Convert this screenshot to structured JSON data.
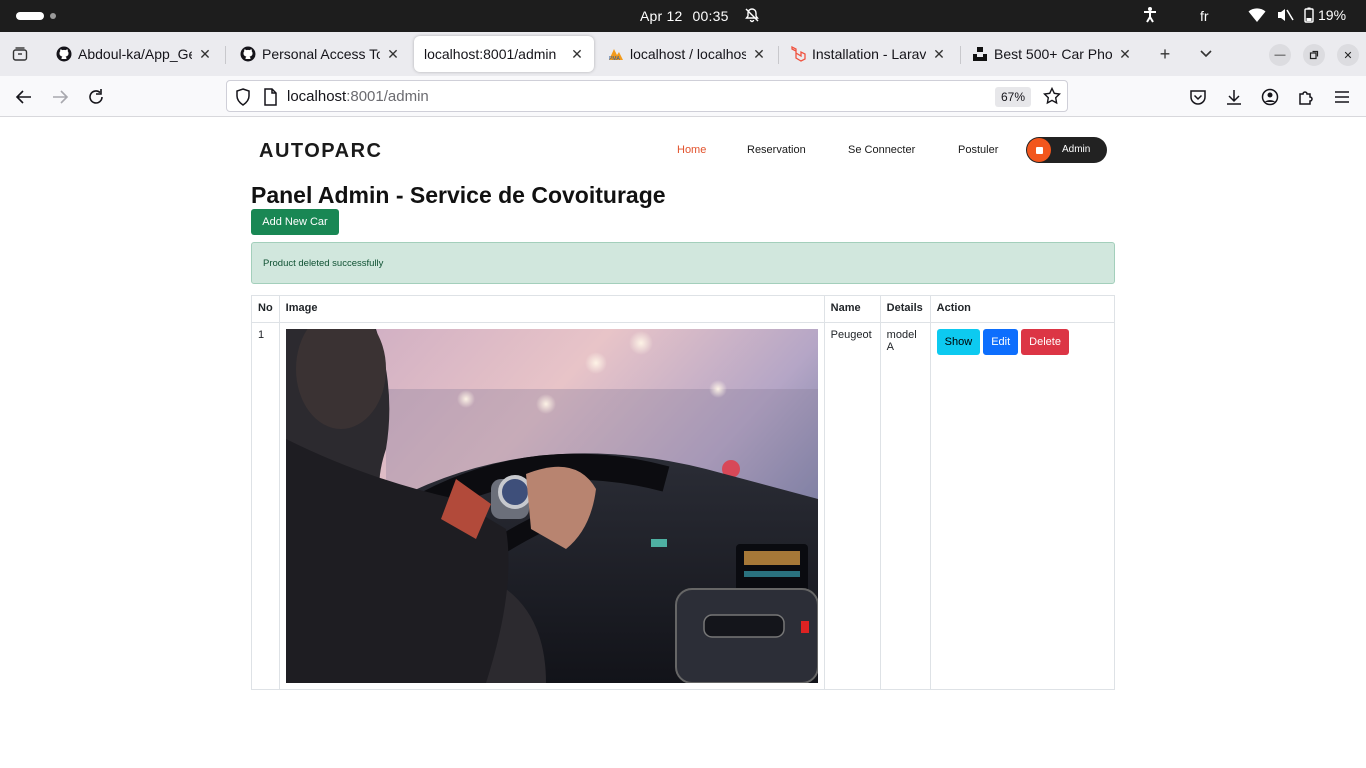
{
  "os": {
    "date": "Apr 12",
    "time": "00:35",
    "language": "fr",
    "battery": "19%"
  },
  "browser": {
    "tabs": [
      {
        "label": "Abdoul-ka/App_Ge",
        "icon": "github-icon"
      },
      {
        "label": "Personal Access To",
        "icon": "github-icon"
      },
      {
        "label": "localhost:8001/admin",
        "icon": "none",
        "active": true
      },
      {
        "label": "localhost / localhos",
        "icon": "phpmyadmin-icon"
      },
      {
        "label": "Installation - Larave",
        "icon": "laravel-icon"
      },
      {
        "label": "Best 500+ Car Phot",
        "icon": "unsplash-icon"
      }
    ],
    "url_host": "localhost",
    "url_rest": ":8001/admin",
    "zoom": "67%"
  },
  "site": {
    "brand": "AUTOPARC",
    "nav": {
      "home": "Home",
      "reservation": "Reservation",
      "login": "Se Connecter",
      "apply": "Postuler",
      "admin": "Admin"
    },
    "title": "Panel Admin - Service de Covoiturage",
    "add_button": "Add New Car",
    "alert": "Product deleted successfully",
    "table": {
      "headers": [
        "No",
        "Image",
        "Name",
        "Details",
        "Action"
      ],
      "rows": [
        {
          "no": "1",
          "name": "Peugeot",
          "details": "model A",
          "image_desc": "man-driving-car-photo"
        }
      ],
      "actions": {
        "show": "Show",
        "edit": "Edit",
        "delete": "Delete"
      }
    },
    "colors": {
      "accent": "#e2532d",
      "success": "#198754",
      "info": "#0dcaf0",
      "primary": "#0d6efd",
      "danger": "#dc3545"
    }
  }
}
